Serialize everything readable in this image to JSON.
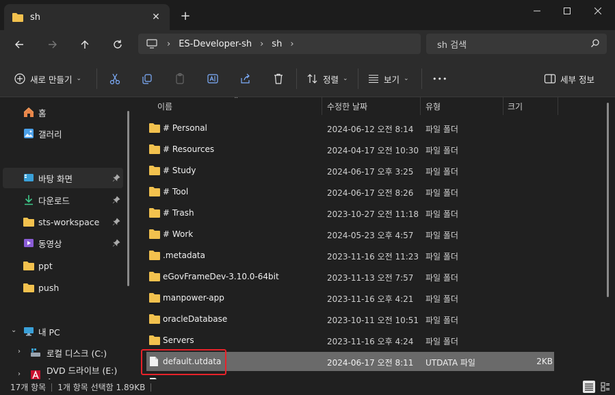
{
  "window": {
    "tab_title": "sh",
    "tab_close": "✕",
    "new_tab": "+"
  },
  "address": {
    "crumbs": [
      "ES-Developer-sh",
      "sh"
    ],
    "separator": "›"
  },
  "search": {
    "placeholder": "sh 검색"
  },
  "commands": {
    "new_label": "새로 만들기",
    "sort_label": "정렬",
    "view_label": "보기",
    "more_label": "•••",
    "details_label": "세부 정보"
  },
  "sidebar": {
    "items": [
      {
        "label": "홈",
        "icon": "home-icon"
      },
      {
        "label": "갤러리",
        "icon": "gallery-icon"
      },
      {
        "label": "바탕 화면",
        "icon": "desktop-icon",
        "pinned": true
      },
      {
        "label": "다운로드",
        "icon": "download-icon",
        "pinned": true
      },
      {
        "label": "sts-workspace",
        "icon": "folder-icon",
        "pinned": true
      },
      {
        "label": "동영상",
        "icon": "video-icon",
        "pinned": true
      },
      {
        "label": "ppt",
        "icon": "folder-icon"
      },
      {
        "label": "push",
        "icon": "folder-icon"
      },
      {
        "label": "내 PC",
        "icon": "pc-icon"
      },
      {
        "label": "로컬 디스크 (C:)",
        "icon": "drive-icon"
      },
      {
        "label": "DVD 드라이브 (E:) Ac",
        "icon": "dvd-icon"
      }
    ]
  },
  "columns": {
    "name": "이름",
    "date": "수정한 날짜",
    "type": "유형",
    "size": "크기"
  },
  "files": [
    {
      "name": "# Personal",
      "date": "2024-06-12 오전 8:14",
      "type": "파일 폴더",
      "size": ""
    },
    {
      "name": "# Resources",
      "date": "2024-04-17 오전 10:30",
      "type": "파일 폴더",
      "size": ""
    },
    {
      "name": "# Study",
      "date": "2024-06-17 오후 3:25",
      "type": "파일 폴더",
      "size": ""
    },
    {
      "name": "# Tool",
      "date": "2024-06-17 오전 8:26",
      "type": "파일 폴더",
      "size": ""
    },
    {
      "name": "# Trash",
      "date": "2023-10-27 오전 11:18",
      "type": "파일 폴더",
      "size": ""
    },
    {
      "name": "# Work",
      "date": "2024-05-23 오후 4:57",
      "type": "파일 폴더",
      "size": ""
    },
    {
      "name": ".metadata",
      "date": "2023-11-16 오전 11:23",
      "type": "파일 폴더",
      "size": ""
    },
    {
      "name": "eGovFrameDev-3.10.0-64bit",
      "date": "2023-11-13 오전 7:57",
      "type": "파일 폴더",
      "size": ""
    },
    {
      "name": "manpower-app",
      "date": "2023-11-16 오후 4:21",
      "type": "파일 폴더",
      "size": ""
    },
    {
      "name": "oracleDatabase",
      "date": "2023-10-11 오전 10:51",
      "type": "파일 폴더",
      "size": ""
    },
    {
      "name": "Servers",
      "date": "2023-11-16 오후 4:24",
      "type": "파일 폴더",
      "size": ""
    },
    {
      "name": "default.utdata",
      "date": "2024-06-17 오전 8:11",
      "type": "UTDATA 파일",
      "size": "2KB",
      "selected": true
    }
  ],
  "status": {
    "count": "17개 항목",
    "selection": "1개 항목 선택함 1.89KB"
  },
  "colors": {
    "folder": "#f2c14e",
    "selection": "#6a6a6a",
    "highlight_box": "#e8232a"
  }
}
